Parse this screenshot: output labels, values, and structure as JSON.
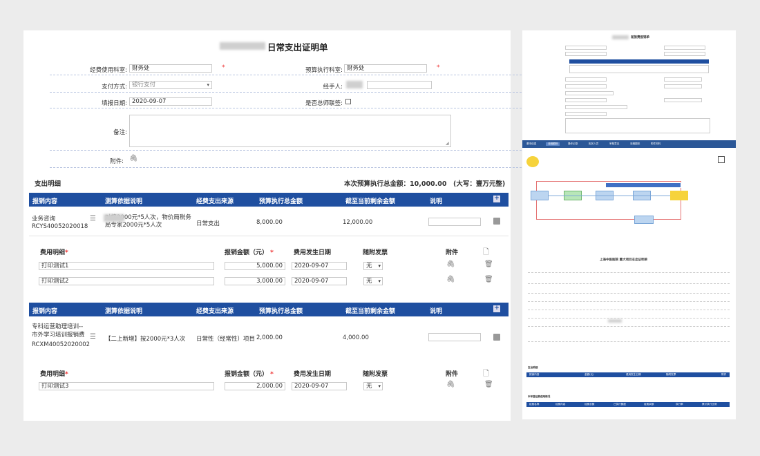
{
  "main_form": {
    "title": "日常支出证明单",
    "fields": {
      "dept_label": "经费使用科室:",
      "dept_value": "财务处",
      "budget_dept_label": "预算执行科室:",
      "budget_dept_value": "财务处",
      "pay_method_label": "支付方式:",
      "pay_method_value": "银行支付",
      "handler_label": "经手人:",
      "date_label": "填报日期:",
      "date_value": "2020-09-07",
      "sign_label": "是否总师联签:",
      "remark_label": "备注:",
      "attachment_label": "附件:",
      "required_mark": "*"
    },
    "detail_title": "支出明细",
    "budget_total": "本次预算执行总金额：10,000.00　(大写：壹万元整)",
    "table_headers": [
      "报销内容",
      "测算依据说明",
      "经费支出来源",
      "预算执行总金额",
      "截至当前剩余金额",
      "说明"
    ],
    "expand_icon": "plus-box-icon",
    "groups": [
      {
        "content": "业务咨询",
        "code": "RCYS40052020018",
        "basis": "对接2000元*5人次，物价局税务局专家2000元*5人次",
        "source": "日常支出",
        "total": "8,000.00",
        "remaining": "12,000.00",
        "sub_headers": [
          "费用明细",
          "报销金额（元）",
          "费用发生日期",
          "随附发票",
          "附件"
        ],
        "items": [
          {
            "name": "打印测试1",
            "amount": "5,000.00",
            "date": "2020-09-07",
            "invoice": "无"
          },
          {
            "name": "打印测试2",
            "amount": "3,000.00",
            "date": "2020-09-07",
            "invoice": "无"
          }
        ]
      },
      {
        "content": "专科运营助理培训--市外学习培训报销费",
        "code": "RCXM40052020002",
        "basis": "【二上新增】按2000元*3人次",
        "source": "日常性（经常性）项目",
        "total": "2,000.00",
        "remaining": "4,000.00",
        "sub_headers": [
          "费用明细",
          "报销金额（元）",
          "费用发生日期",
          "随附发票",
          "附件"
        ],
        "items": [
          {
            "name": "打印测试3",
            "amount": "2,000.00",
            "date": "2020-09-07",
            "invoice": "无"
          }
        ]
      }
    ]
  },
  "side_panel": {
    "top_title": "差旅费报销单",
    "tabs": [
      "基本信息",
      "流程跟踪",
      "操作记录",
      "相关人员",
      "审核意见",
      "流程图形",
      "附件材料"
    ],
    "flow_nodes": [
      "开始",
      "申请",
      "科室审核",
      "财务审核",
      "院领导",
      "结束",
      "归档"
    ],
    "doc_title": "上海中医医院 重大项目支出证明单",
    "section1": "支出明细",
    "section2": "本年度经费使用情况",
    "table1_headers": [
      "报销内容",
      "金额(元)",
      "费用发生日期",
      "随附发票",
      "附件"
    ],
    "table2_headers": [
      "经费名称",
      "经费内容",
      "经费总额",
      "已执行额度",
      "经费余额",
      "执行率",
      "累计执行比例"
    ]
  }
}
